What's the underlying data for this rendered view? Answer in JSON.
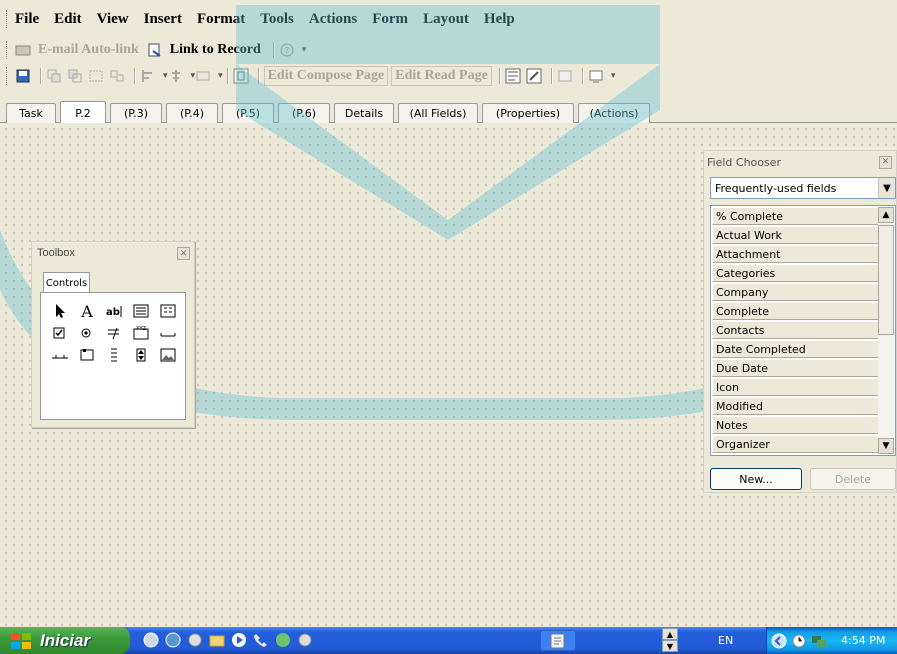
{
  "menu": [
    "File",
    "Edit",
    "View",
    "Insert",
    "Format",
    "Tools",
    "Actions",
    "Form",
    "Layout",
    "Help"
  ],
  "toolbar1": {
    "email_autolink": "E-mail Auto-link",
    "link_to_record": "Link to Record"
  },
  "toolbar2": {
    "edit_compose_page": "Edit Compose Page",
    "edit_read_page": "Edit Read Page"
  },
  "tabs": [
    "Task",
    "P.2",
    "(P.3)",
    "(P.4)",
    "(P.5)",
    "(P.6)",
    "Details",
    "(All Fields)",
    "(Properties)",
    "(Actions)"
  ],
  "active_tab": "P.2",
  "toolbox": {
    "title": "Toolbox",
    "tab": "Controls",
    "tools": [
      "select-objects",
      "label",
      "textbox",
      "frame",
      "option-group",
      "checkbox",
      "option-button",
      "combo-box",
      "list-box",
      "command-button",
      "tab-strip",
      "multi-page",
      "scroll-bar",
      "spin-button",
      "image"
    ]
  },
  "field_chooser": {
    "title": "Field Chooser",
    "selected_set": "Frequently-used fields",
    "fields": [
      "% Complete",
      "Actual Work",
      "Attachment",
      "Categories",
      "Company",
      "Complete",
      "Contacts",
      "Date Completed",
      "Due Date",
      "Icon",
      "Modified",
      "Notes",
      "Organizer"
    ],
    "new_button": "New...",
    "delete_button": "Delete"
  },
  "taskbar": {
    "start_label": "Iniciar",
    "language": "EN",
    "clock": "4:54 PM"
  },
  "colors": {
    "watermark": "#5fbfd3",
    "taskbar_blue": "#245edc",
    "start_green": "#3c9a3c"
  }
}
